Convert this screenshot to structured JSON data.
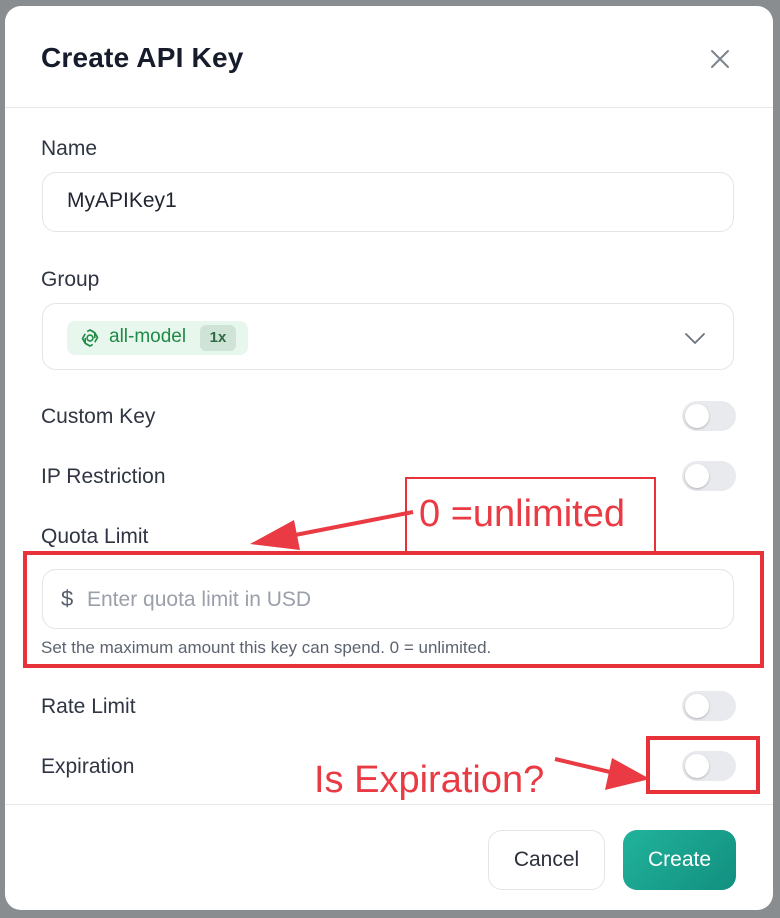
{
  "dialog": {
    "title": "Create API Key",
    "close_icon": "close-icon"
  },
  "name_field": {
    "label": "Name",
    "value": "MyAPIKey1"
  },
  "group_field": {
    "label": "Group",
    "selected_tag": "all-model",
    "selected_badge": "1x",
    "tag_icon": "openai-logo-icon",
    "chevron_icon": "chevron-down-icon"
  },
  "custom_key": {
    "label": "Custom Key",
    "enabled": false
  },
  "ip_restriction": {
    "label": "IP Restriction",
    "enabled": false
  },
  "quota_limit": {
    "label": "Quota Limit",
    "currency_symbol": "$",
    "placeholder": "Enter quota limit in USD",
    "value": "",
    "help_text": "Set the maximum amount this key can spend. 0 = unlimited."
  },
  "rate_limit": {
    "label": "Rate Limit",
    "enabled": false
  },
  "expiration": {
    "label": "Expiration",
    "enabled": false
  },
  "footer": {
    "cancel_label": "Cancel",
    "create_label": "Create"
  },
  "annotations": {
    "quota_note": "0 =unlimited",
    "expiration_note": "Is Expiration?",
    "color": "#e8323a"
  },
  "colors": {
    "accent_start": "#21b39b",
    "accent_end": "#128f80",
    "tag_background": "#e8f7ee",
    "tag_text": "#1e8a45"
  }
}
